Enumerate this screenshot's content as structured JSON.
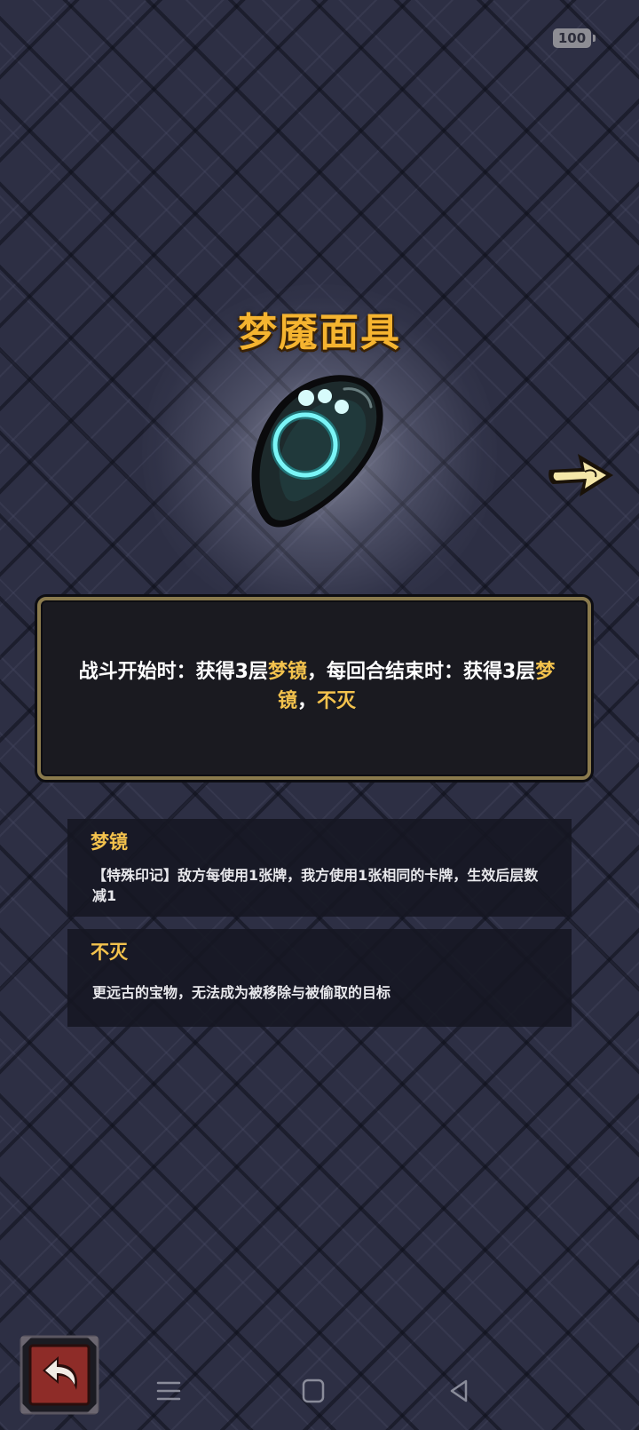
{
  "status_bar": {
    "battery_level": "100"
  },
  "relic": {
    "name": "梦魇面具",
    "icon": "nightmare-mask-icon"
  },
  "description": {
    "part1": "战斗开始时：获得3层",
    "keyword1": "梦镜",
    "part2": "，每回合结束时：获得3层",
    "keyword2": "梦镜",
    "part3": "，",
    "keyword3": "不灭"
  },
  "keywords": [
    {
      "title": "梦镜",
      "description": "【特殊印记】敌方每使用1张牌，我方使用1张相同的卡牌，生效后层数减1"
    },
    {
      "title": "不灭",
      "description": "更远古的宝物，无法成为被移除与被偷取的目标"
    }
  ],
  "navigation": {
    "next_icon": "arrow-right-icon",
    "back_icon": "return-arrow-icon"
  },
  "system_nav": {
    "menu_icon": "menu-icon",
    "home_icon": "home-icon",
    "back_icon": "back-triangle-icon"
  },
  "colors": {
    "background": "#2d2f44",
    "title": "#f5b430",
    "highlight": "#f3c24d",
    "box_border": "#8a7a4d",
    "relic_glow": "#27e6ea"
  }
}
